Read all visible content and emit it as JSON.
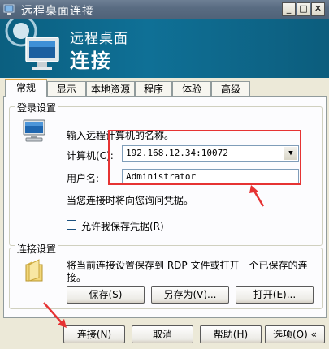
{
  "window": {
    "title": "远程桌面连接"
  },
  "banner": {
    "line1": "远程桌面",
    "line2": "连接"
  },
  "tabs": [
    {
      "label": "常规"
    },
    {
      "label": "显示"
    },
    {
      "label": "本地资源"
    },
    {
      "label": "程序"
    },
    {
      "label": "体验"
    },
    {
      "label": "高级"
    }
  ],
  "login": {
    "group_label": "登录设置",
    "prompt": "输入远程计算机的名称。",
    "computer_label": "计算机(C):",
    "computer_value": "192.168.12.34:10072",
    "username_label": "用户名:",
    "username_value": "Administrator",
    "credentials_note": "当您连接时将向您询问凭据。",
    "save_credentials_label": "允许我保存凭据(R)",
    "save_credentials_checked": false
  },
  "connection": {
    "group_label": "连接设置",
    "description_line1": "将当前连接设置保存到 RDP 文件或打开一个已保存的连",
    "description_line2": "接。",
    "save_button": "保存(S)",
    "save_as_button": "另存为(V)...",
    "open_button": "打开(E)..."
  },
  "footer": {
    "connect_button": "连接(N)",
    "cancel_button": "取消",
    "help_button": "帮助(H)",
    "options_button": "选项(O)"
  },
  "colors": {
    "banner": "#0f7096",
    "highlight": "#e63333",
    "active_tab_accent": "#e6a840"
  }
}
